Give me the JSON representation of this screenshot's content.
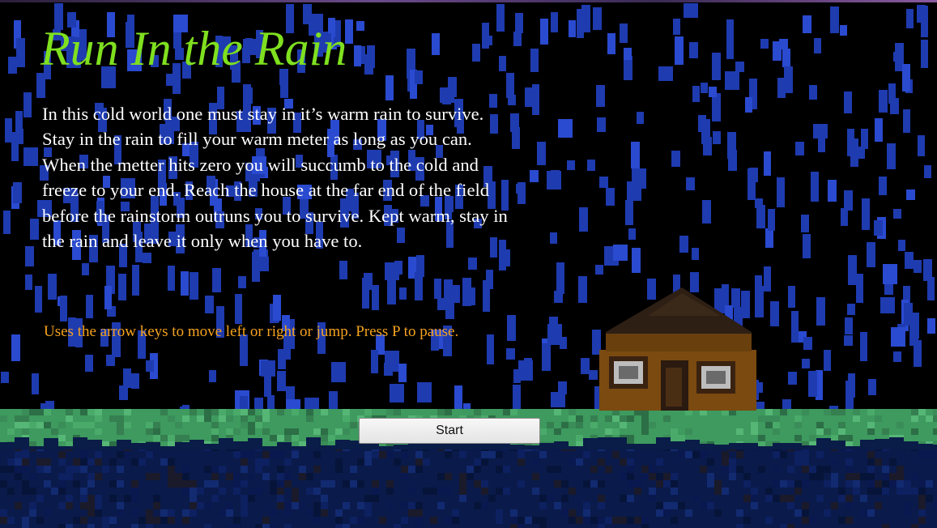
{
  "game": {
    "title": "Run In the Rain",
    "story": "In this cold world one must stay in it’s warm rain to survive. Stay in the rain to fill your warm meter as long as you can. When the metter hits zero you will succumb to the cold and freeze to your end. Reach the house at the far end of the field before the rainstorm outruns you to survive. Kept warm, stay in the rain and leave it only when you have to.",
    "controls": "Uses the arrow keys to move left or right or jump.  Press P to pause.",
    "start_label": "Start"
  },
  "colors": {
    "background": "#000000",
    "rain": "#1e3bb0",
    "title": "#7fe01f",
    "story_text": "#ffffff",
    "controls_text": "#f5a21e",
    "grass": "#3e9a5e",
    "ground": "#0a1a4a",
    "house_wall": "#7a4a10",
    "house_roof": "#2e1f14"
  },
  "icons": {
    "house": "pixel-house-icon"
  }
}
